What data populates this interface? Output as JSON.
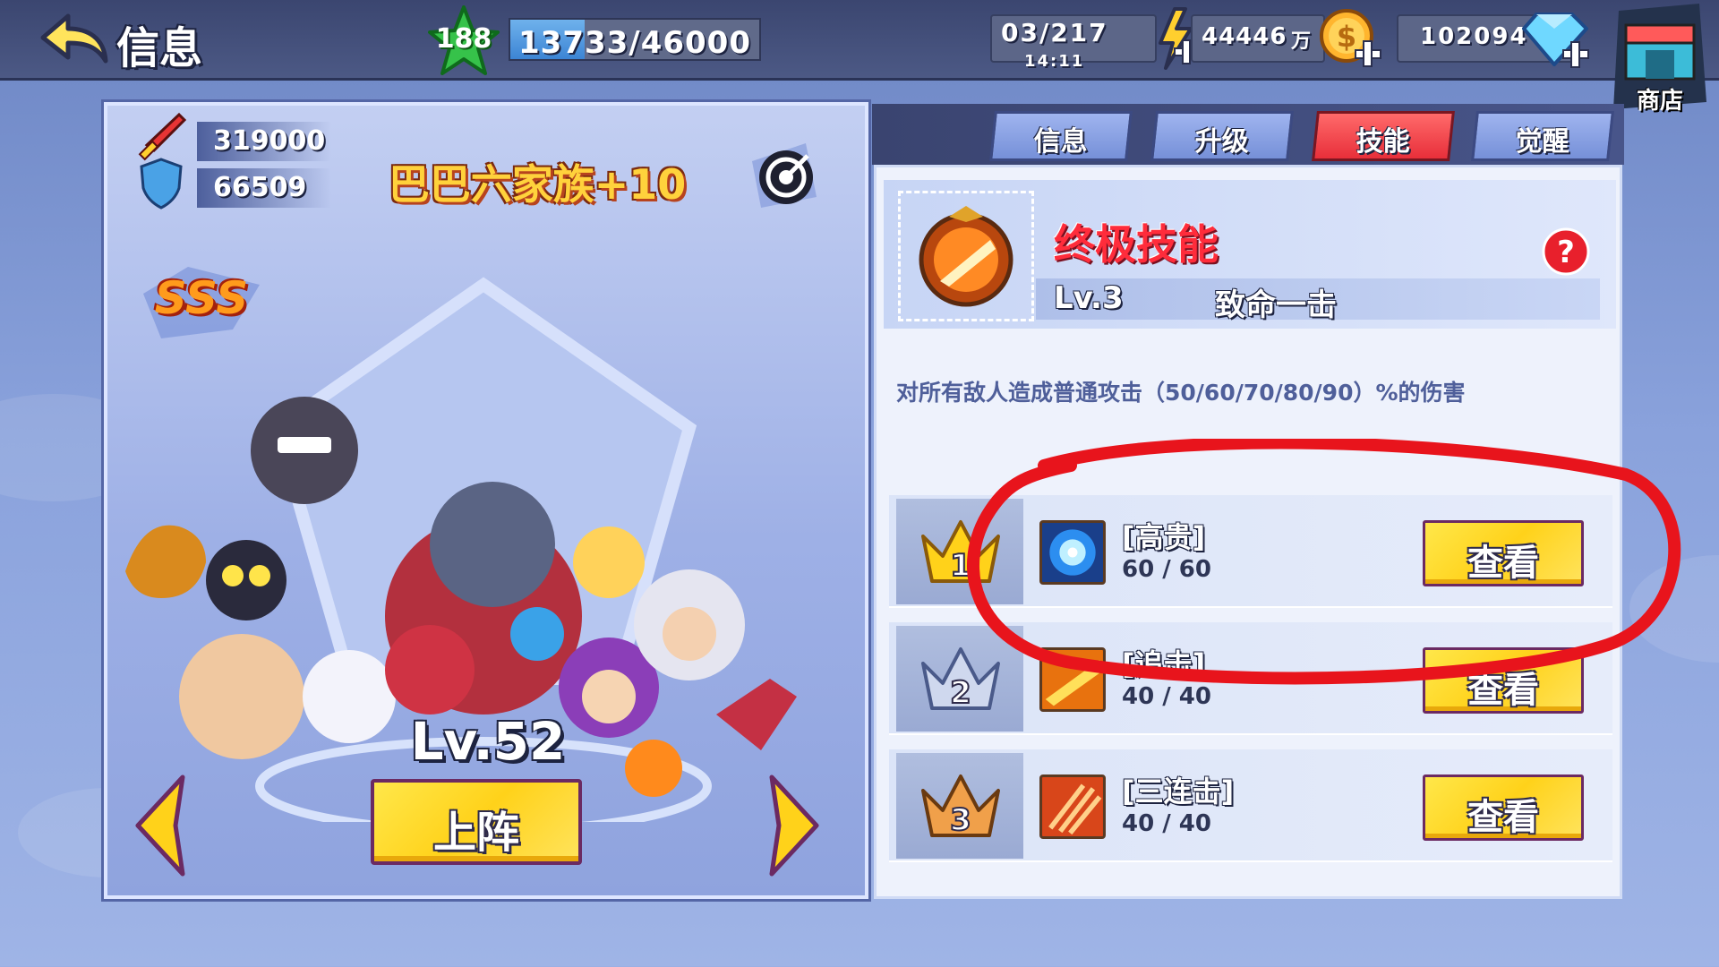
{
  "header": {
    "title": "信息",
    "player_level": "188",
    "exp_text": "13733/46000",
    "exp_progress": 0.2985,
    "stamina": "03/217",
    "stamina_timer": "14:11",
    "gold": "44446",
    "gold_unit": "万",
    "gems": "102094",
    "shop_label": "商店"
  },
  "hero": {
    "attack": "319000",
    "defense": "66509",
    "team_name": "巴巴六家族+10",
    "grade": "SSS",
    "level": "Lv.52",
    "deploy_label": "上阵"
  },
  "tabs": [
    {
      "label": "信息",
      "active": false
    },
    {
      "label": "升级",
      "active": false
    },
    {
      "label": "技能",
      "active": true
    },
    {
      "label": "觉醒",
      "active": false
    }
  ],
  "ultimate": {
    "title": "终极技能",
    "level": "Lv.3",
    "name": "致命一击",
    "description": "对所有敌人造成普通攻击（50/60/70/80/90）%的伤害"
  },
  "skills": [
    {
      "rank": "1",
      "name": "[高贵]",
      "count": "60 / 60",
      "button": "查看",
      "icon": "blue-orb-icon"
    },
    {
      "rank": "2",
      "name": "[追击]",
      "count": "40 / 40",
      "button": "查看",
      "icon": "fire-slash-icon"
    },
    {
      "rank": "3",
      "name": "[三连击]",
      "count": "40 / 40",
      "button": "查看",
      "icon": "claw-strike-icon"
    }
  ],
  "colors": {
    "active_tab": "#e82f3a",
    "button_yellow": "#ffd21a",
    "annotation_red": "#e8141c",
    "ult_title": "#ff2c3b"
  }
}
